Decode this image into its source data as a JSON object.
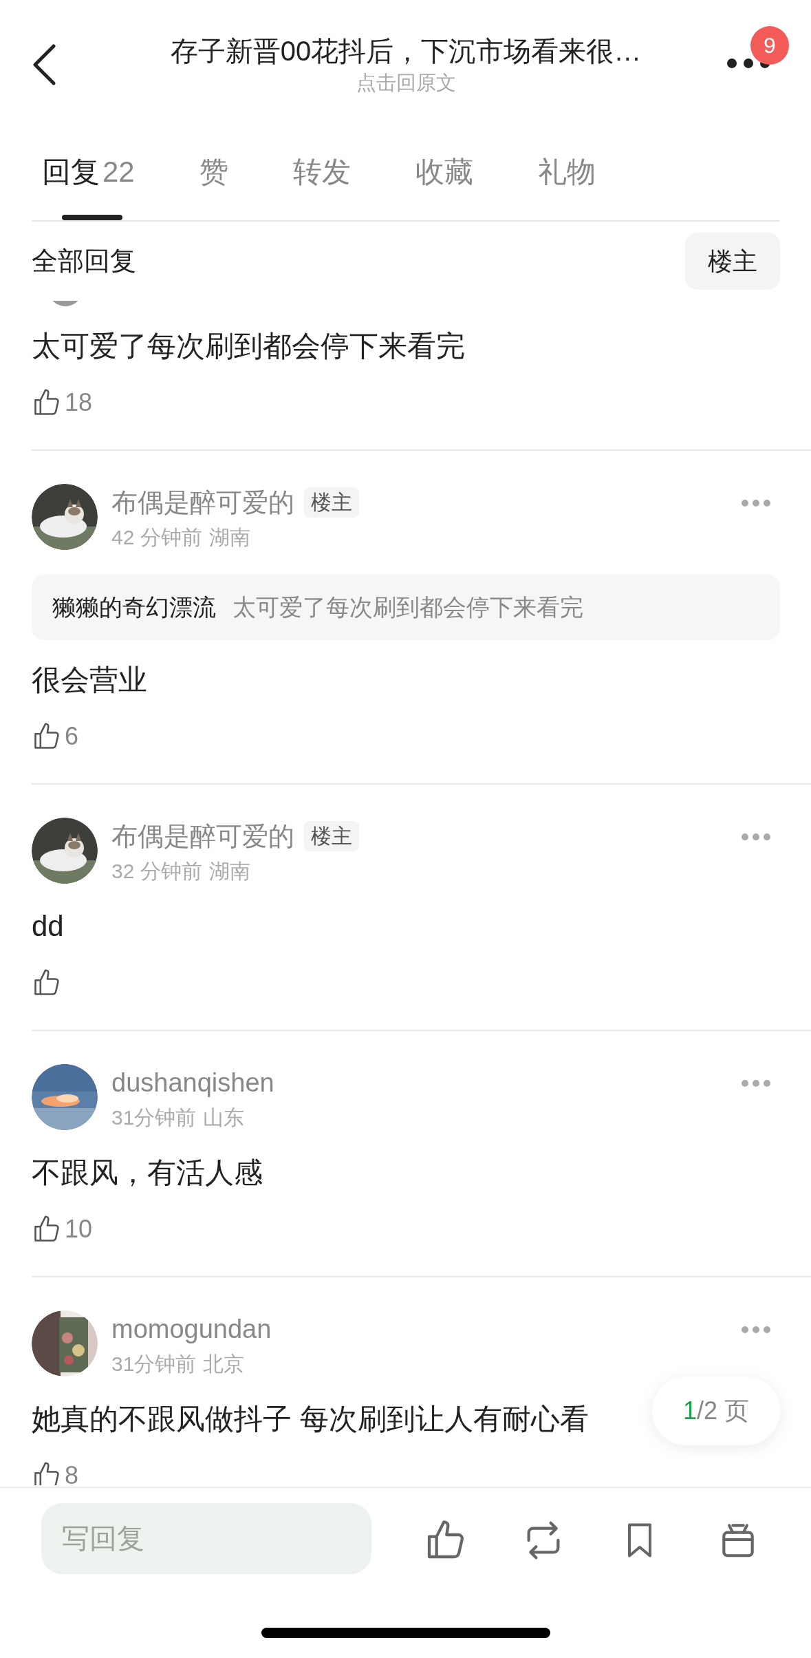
{
  "header": {
    "title": "存子新晋00花抖后，下沉市场看来很…",
    "subtitle": "点击回原文",
    "badge": "9"
  },
  "tabs": [
    {
      "label": "回复",
      "count": "22",
      "selected": true
    },
    {
      "label": "赞",
      "selected": false
    },
    {
      "label": "转发",
      "selected": false
    },
    {
      "label": "收藏",
      "selected": false
    },
    {
      "label": "礼物",
      "selected": false
    }
  ],
  "filter": {
    "label": "全部回复",
    "button": "楼主"
  },
  "comments": [
    {
      "text": "太可爱了每次刷到都会停下来看完",
      "likes": "18"
    },
    {
      "author": "布偶是醉可爱的",
      "tag": "楼主",
      "time": "42 分钟前",
      "location": "湖南",
      "quote": {
        "author": "獭獭的奇幻漂流",
        "text": "太可爱了每次刷到都会停下来看完"
      },
      "text": "很会营业",
      "likes": "6"
    },
    {
      "author": "布偶是醉可爱的",
      "tag": "楼主",
      "time": "32 分钟前",
      "location": "湖南",
      "text": "dd"
    },
    {
      "author": "dushanqishen",
      "time": "31分钟前",
      "location": "山东",
      "text": "不跟风，有活人感",
      "likes": "10"
    },
    {
      "author": "momogundan",
      "time": "31分钟前",
      "location": "北京",
      "text": "她真的不跟风做抖子 每次刷到让人有耐心看",
      "likes": "8"
    }
  ],
  "pager": {
    "current": "1",
    "total": "/2 页"
  },
  "bottom_bar": {
    "placeholder": "写回复"
  }
}
